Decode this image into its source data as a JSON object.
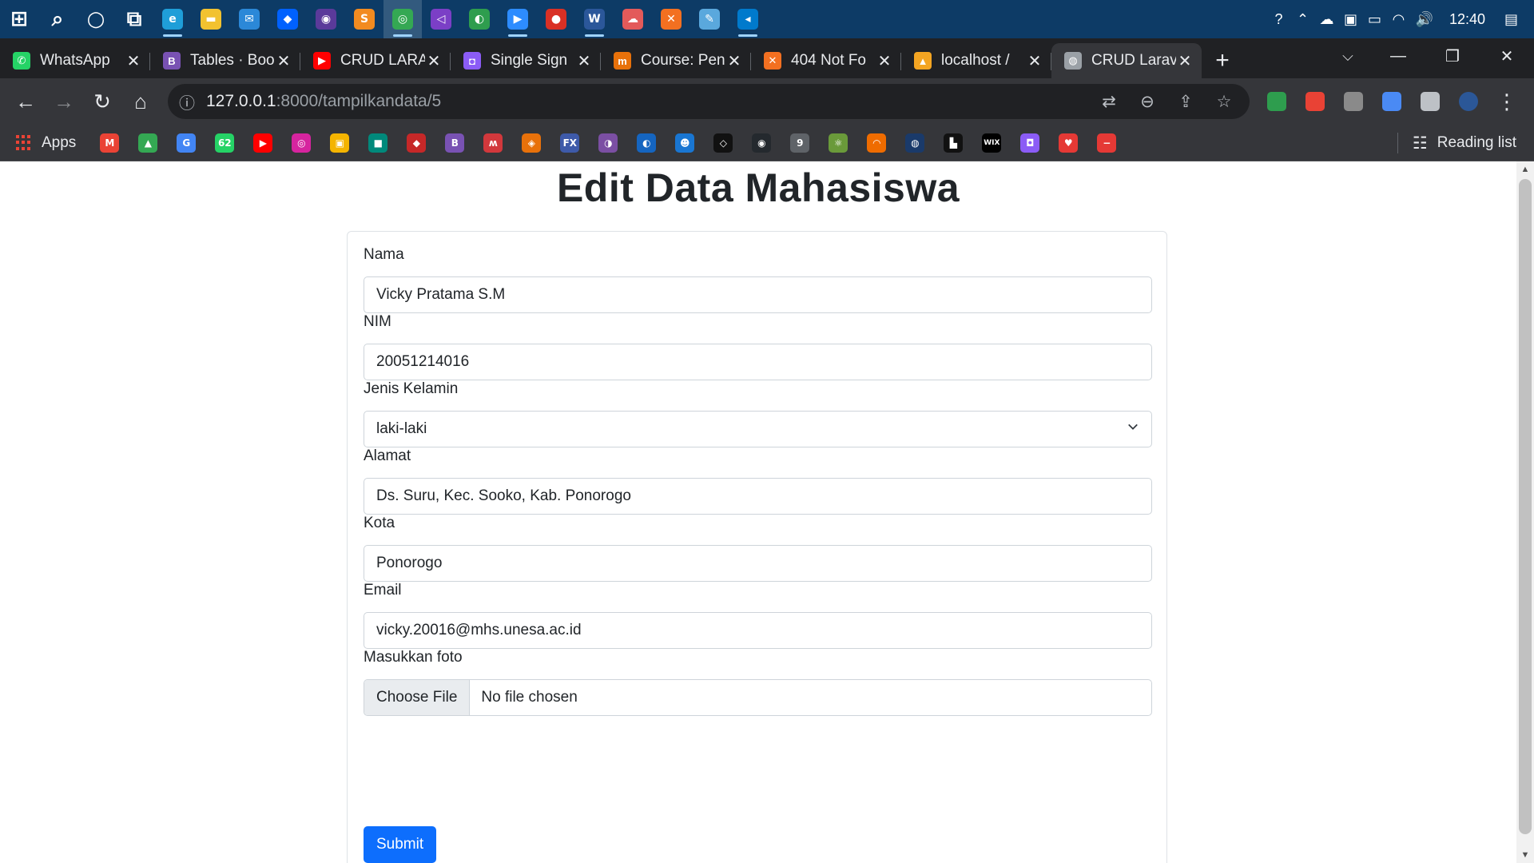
{
  "taskbar": {
    "apps": [
      {
        "icon": "windows-start-icon",
        "glyph": "⊞",
        "color": "#0d3b66"
      },
      {
        "icon": "search-icon",
        "glyph": "⌕",
        "color": "#0d3b66"
      },
      {
        "icon": "cortana-icon",
        "glyph": "○",
        "color": "#0d3b66"
      },
      {
        "icon": "task-view-icon",
        "glyph": "⧉",
        "color": "#0d3b66"
      },
      {
        "icon": "edge-icon",
        "glyph": "e",
        "color": "#1f9ed8"
      },
      {
        "icon": "file-explorer-icon",
        "glyph": "▬",
        "color": "#f2c230"
      },
      {
        "icon": "mail-icon",
        "glyph": "✉",
        "color": "#2b88d8"
      },
      {
        "icon": "dropbox-icon",
        "glyph": "◆",
        "color": "#0061fe"
      },
      {
        "icon": "github-desktop-icon",
        "glyph": "◉",
        "color": "#5a3a9a"
      },
      {
        "icon": "sublime-text-icon",
        "glyph": "S",
        "color": "#f28b20"
      },
      {
        "icon": "chrome-icon",
        "glyph": "◎",
        "color": "#34a853"
      },
      {
        "icon": "visual-studio-icon",
        "glyph": "◁",
        "color": "#7b3fc6"
      },
      {
        "icon": "sync-icon",
        "glyph": "◐",
        "color": "#2e9d4e"
      },
      {
        "icon": "zoom-icon",
        "glyph": "▶",
        "color": "#2d8cff"
      },
      {
        "icon": "screen-recorder-icon",
        "glyph": "●",
        "color": "#d93025"
      },
      {
        "icon": "word-icon",
        "glyph": "W",
        "color": "#2b579a"
      },
      {
        "icon": "cloud-app-icon",
        "glyph": "☁",
        "color": "#e35a5a"
      },
      {
        "icon": "xampp-icon",
        "glyph": "✕",
        "color": "#f37021"
      },
      {
        "icon": "notepad-icon",
        "glyph": "✎",
        "color": "#5aa8dd"
      },
      {
        "icon": "vscode-icon",
        "glyph": "◂",
        "color": "#007acc"
      }
    ],
    "tray": {
      "help_icon": "?",
      "chevron_icon": "⌃",
      "onedrive_icon": "☁",
      "meet_icon": "▣",
      "battery_icon": "▭",
      "wifi_icon": "◠",
      "volume_icon": "🔊",
      "clock": "12:40",
      "notification_icon": "▤"
    }
  },
  "tabs": [
    {
      "title": "WhatsApp",
      "fav": "✆",
      "color": "#25d366",
      "active": false
    },
    {
      "title": "Tables · Boo",
      "fav": "B",
      "color": "#7952b3",
      "active": false
    },
    {
      "title": "CRUD LARA",
      "fav": "▶",
      "color": "#ff0000",
      "active": false
    },
    {
      "title": "Single Sign",
      "fav": "◘",
      "color": "#8b5cf6",
      "active": false
    },
    {
      "title": "Course: Pen",
      "fav": "m",
      "color": "#e8710a",
      "active": false
    },
    {
      "title": "404 Not Fo",
      "fav": "✕",
      "color": "#f37021",
      "active": false
    },
    {
      "title": "localhost /",
      "fav": "▲",
      "color": "#f4a522",
      "active": false
    },
    {
      "title": "CRUD Larav",
      "fav": "◍",
      "color": "#9aa0a6",
      "active": true
    }
  ],
  "toolbar": {
    "back": "←",
    "forward": "→",
    "reload": "↻",
    "home": "⌂",
    "info": "ⓘ",
    "url_host": "127.0.0.1",
    "url_rest": ":8000/tampilkandata/5",
    "translate": "⇄",
    "zoom": "⊖",
    "share": "⇪",
    "star": "☆",
    "menu": "⋮"
  },
  "extensions": [
    "#2e9d4e",
    "#e94235",
    "#8a8a8a",
    "#4a8af4",
    "#bdc1c6",
    "#2b5797"
  ],
  "bookmarks": {
    "apps_label": "Apps",
    "items": [
      {
        "icon": "gmail-icon",
        "glyph": "M",
        "color": "#ea4335"
      },
      {
        "icon": "drive-icon",
        "glyph": "▲",
        "color": "#34a853"
      },
      {
        "icon": "google-icon",
        "glyph": "G",
        "color": "#4285f4"
      },
      {
        "icon": "whatsapp-badge-icon",
        "glyph": "62",
        "color": "#25d366"
      },
      {
        "icon": "youtube-icon",
        "glyph": "▶",
        "color": "#ff0000"
      },
      {
        "icon": "instagram-icon",
        "glyph": "◎",
        "color": "#d6249f"
      },
      {
        "icon": "classroom-icon",
        "glyph": "▣",
        "color": "#f4b400"
      },
      {
        "icon": "meet-icon",
        "glyph": "■",
        "color": "#00897b"
      },
      {
        "icon": "cube-icon",
        "glyph": "◆",
        "color": "#c62828"
      },
      {
        "icon": "bootstrap-icon",
        "glyph": "B",
        "color": "#7952b3"
      },
      {
        "icon": "mendeley-icon",
        "glyph": "ʍ",
        "color": "#d2383c"
      },
      {
        "icon": "shield-icon",
        "glyph": "◈",
        "color": "#e8710a"
      },
      {
        "icon": "fx-icon",
        "glyph": "FX",
        "color": "#3e5aa9"
      },
      {
        "icon": "figure-icon",
        "glyph": "◑",
        "color": "#7b4fa3"
      },
      {
        "icon": "blue-blob-icon",
        "glyph": "◐",
        "color": "#1565c0"
      },
      {
        "icon": "reddit-like-icon",
        "glyph": "☻",
        "color": "#1976d2"
      },
      {
        "icon": "codepen-icon",
        "glyph": "◇",
        "color": "#111111"
      },
      {
        "icon": "github-icon",
        "glyph": "◉",
        "color": "#24292e"
      },
      {
        "icon": "nine-icon",
        "glyph": "9",
        "color": "#5f6368"
      },
      {
        "icon": "atom-icon",
        "glyph": "⚛",
        "color": "#6a9a3a"
      },
      {
        "icon": "rainbow-icon",
        "glyph": "◠",
        "color": "#ef6c00"
      },
      {
        "icon": "globe-icon",
        "glyph": "◍",
        "color": "#1a3a6a"
      },
      {
        "icon": "unsplash-icon",
        "glyph": "▙",
        "color": "#111111"
      },
      {
        "icon": "wix-icon",
        "glyph": "WIX",
        "color": "#000000"
      },
      {
        "icon": "gamma-icon",
        "glyph": "◘",
        "color": "#8b5cf6"
      },
      {
        "icon": "heart-icon",
        "glyph": "♥",
        "color": "#e53935"
      },
      {
        "icon": "red-square-icon",
        "glyph": "−",
        "color": "#e53935"
      }
    ],
    "reading_list": "Reading list"
  },
  "page": {
    "title": "Edit Data Mahasiswa",
    "form": {
      "nama": {
        "label": "Nama",
        "value": "Vicky Pratama S.M"
      },
      "nim": {
        "label": "NIM",
        "value": "20051214016"
      },
      "jenis_kelamin": {
        "label": "Jenis Kelamin",
        "value": "laki-laki"
      },
      "alamat": {
        "label": "Alamat",
        "value": "Ds. Suru, Kec. Sooko, Kab. Ponorogo"
      },
      "kota": {
        "label": "Kota",
        "value": "Ponorogo"
      },
      "email": {
        "label": "Email",
        "value": "vicky.20016@mhs.unesa.ac.id"
      },
      "foto": {
        "label": "Masukkan foto",
        "button": "Choose File",
        "status": "No file chosen"
      },
      "submit": "Submit"
    }
  }
}
